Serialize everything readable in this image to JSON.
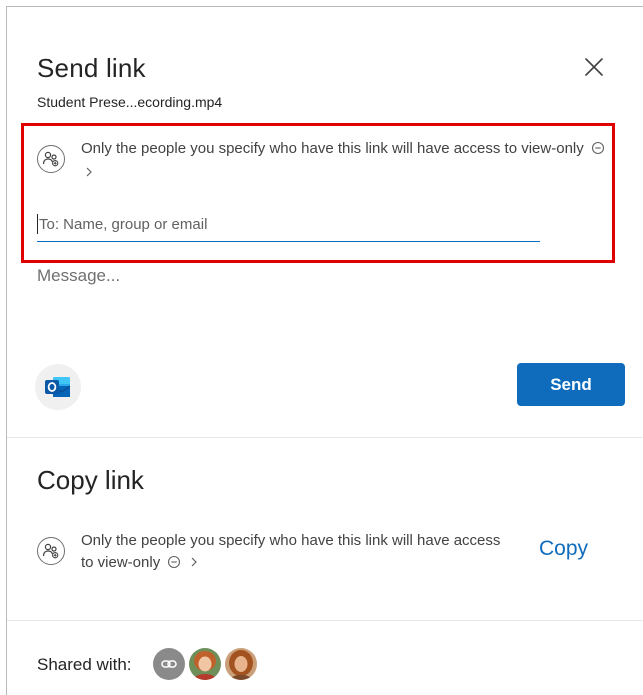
{
  "send_link": {
    "title": "Send link",
    "filename": "Student Prese...ecording.mp4",
    "permission_text": "Only the people you specify who have this link will have access to view-only",
    "to_placeholder": "To: Name, group or email",
    "message_placeholder": "Message...",
    "send_label": "Send",
    "outlook_icon": "outlook-icon"
  },
  "copy_link": {
    "title": "Copy link",
    "permission_text": "Only the people you specify who have this link will have access to view-only",
    "copy_label": "Copy"
  },
  "shared_with": {
    "label": "Shared with:",
    "avatars": [
      "link-icon",
      "user-avatar-1",
      "user-avatar-2"
    ]
  },
  "colors": {
    "accent": "#0f6cbd",
    "highlight": "#e00000"
  }
}
